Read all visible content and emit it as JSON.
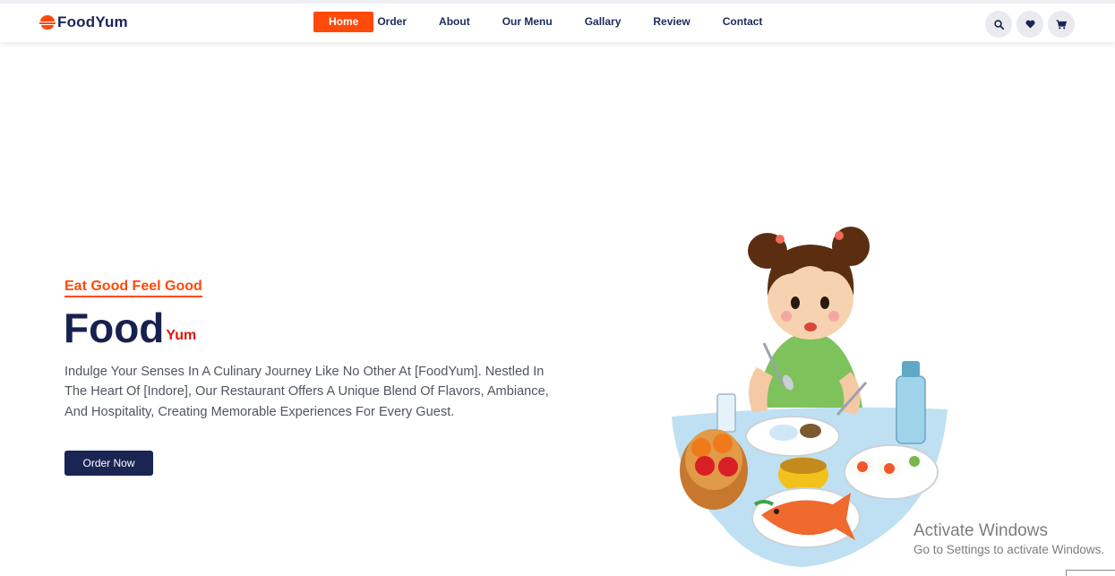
{
  "brand": {
    "name": "FoodYum",
    "icon": "bowl-icon",
    "accent": "#ff4a0a"
  },
  "nav": {
    "items": [
      {
        "label": "Home",
        "active": true
      },
      {
        "label": "Order"
      },
      {
        "label": "About"
      },
      {
        "label": "Our Menu"
      },
      {
        "label": "Gallary"
      },
      {
        "label": "Review"
      },
      {
        "label": "Contact"
      }
    ]
  },
  "actions": {
    "icons": [
      "search-icon",
      "heart-icon",
      "cart-icon"
    ]
  },
  "hero": {
    "tagline": "Eat Good Feel Good",
    "title_main": "Food",
    "title_sub": "Yum",
    "description": "Indulge Your Senses In A Culinary Journey Like No Other At [FoodYum]. Nestled In The Heart Of [Indore], Our Restaurant Offers A Unique Blend Of Flavors, Ambiance, And Hospitality, Creating Memorable Experiences For Every Guest.",
    "button_label": "Order Now",
    "image": "girl-eating-meal-illustration"
  },
  "os_watermark": {
    "line1": "Activate Windows",
    "line2": "Go to Settings to activate Windows."
  },
  "colors": {
    "primary": "#1b2554",
    "accent": "#ff4a0a",
    "sub_title": "#e3150a"
  }
}
